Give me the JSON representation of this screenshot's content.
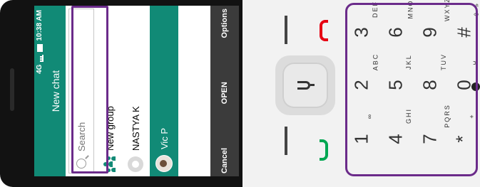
{
  "status": {
    "network": "4G",
    "time": "10:38 AM"
  },
  "header": {
    "title": "New chat"
  },
  "search": {
    "placeholder": "Search"
  },
  "list": [
    {
      "label": "New group",
      "icon": "group-icon"
    },
    {
      "label": "NASTYA K",
      "icon": "avatar-placeholder-icon"
    },
    {
      "label": "Vic P",
      "icon": "avatar-photo-icon",
      "selected": true
    }
  ],
  "softkeys": {
    "left": "Cancel",
    "center": "OPEN",
    "right": "Options"
  },
  "keypad": [
    {
      "num": "3",
      "letters": "DEF"
    },
    {
      "num": "6",
      "letters": "MNO"
    },
    {
      "num": "9",
      "letters": "WXYZ"
    },
    {
      "num": "#",
      "letters": "⇧ »"
    },
    {
      "num": "2",
      "letters": "ABC"
    },
    {
      "num": "5",
      "letters": "JKL"
    },
    {
      "num": "8",
      "letters": "TUV"
    },
    {
      "num": "0",
      "letters": "␣"
    },
    {
      "num": "1",
      "letters": "∞"
    },
    {
      "num": "4",
      "letters": "GHI"
    },
    {
      "num": "7",
      "letters": "PQRS"
    },
    {
      "num": "*",
      "letters": "+"
    }
  ],
  "colors": {
    "accent": "#118a76",
    "softkey_bar": "#3b3b3b",
    "end_key": "#e60012",
    "call_key": "#00a651",
    "highlight": "#6b2b8a"
  }
}
